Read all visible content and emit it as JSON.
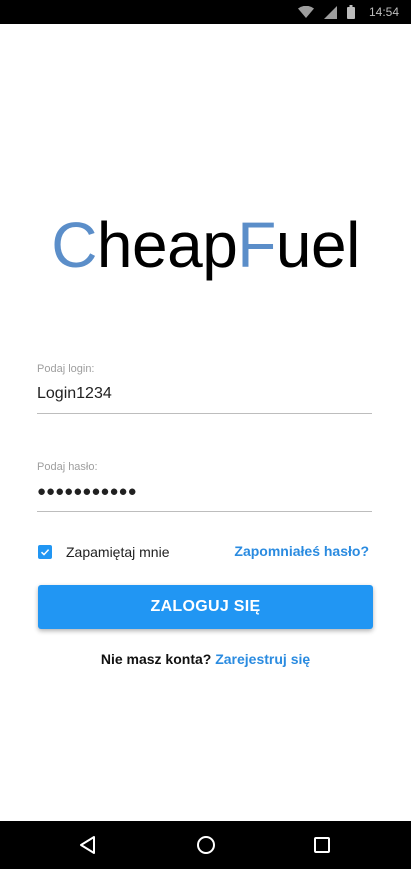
{
  "status_bar": {
    "time": "14:54",
    "icons": [
      "wifi-icon",
      "cellular-signal-icon",
      "battery-icon"
    ]
  },
  "logo": {
    "part1_accent": "C",
    "part1_rest": "heap",
    "part2_accent": "F",
    "part2_rest": "uel",
    "accent_color": "#5b8ec9"
  },
  "login_field": {
    "label": "Podaj login:",
    "value": "Login1234"
  },
  "password_field": {
    "label": "Podaj hasło:",
    "value": "●●●●●●●●●●●"
  },
  "remember": {
    "label": "Zapamiętaj mnie",
    "checked": true
  },
  "forgot_link": "Zapomniałeś hasło?",
  "login_button": "ZALOGUJ SIĘ",
  "signup": {
    "prompt": "Nie masz konta?",
    "link": "Zarejestruj się"
  },
  "nav_bar": {
    "icons": [
      "back-icon",
      "home-icon",
      "recents-icon"
    ]
  },
  "colors": {
    "primary": "#2196f3",
    "link": "#2a8be0"
  }
}
